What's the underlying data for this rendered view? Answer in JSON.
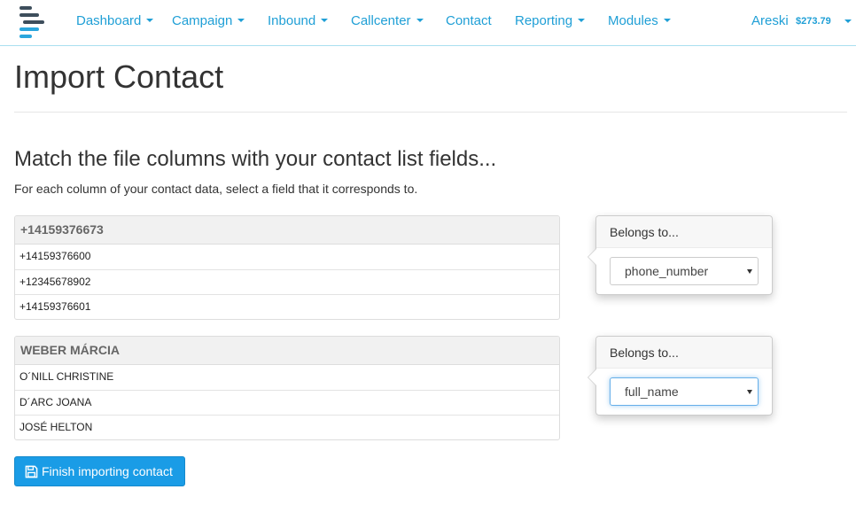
{
  "navbar": {
    "items": [
      {
        "label": "Dashboard",
        "has_caret": true
      },
      {
        "label": "Campaign",
        "has_caret": true
      },
      {
        "label": "Inbound",
        "has_caret": true
      },
      {
        "label": "Callcenter",
        "has_caret": true
      },
      {
        "label": "Contact",
        "has_caret": false
      },
      {
        "label": "Reporting",
        "has_caret": true
      },
      {
        "label": "Modules",
        "has_caret": true
      }
    ],
    "user": {
      "name": "Areski",
      "balance": "$273.79"
    },
    "logo_icon": "logo-stacked-bars-icon",
    "accent_color": "#1f9fd6"
  },
  "page": {
    "title": "Import Contact",
    "section_title": "Match the file columns with your contact list fields...",
    "section_desc": "For each column of your contact data, select a field that it corresponds to."
  },
  "columns": [
    {
      "header": "+14159376673",
      "rows": [
        "+14159376600",
        "+12345678902",
        "+14159376601"
      ],
      "belongs_label": "Belongs to...",
      "selected_field": "phone_number",
      "focused": false
    },
    {
      "header": "WEBER MÁRCIA",
      "rows": [
        "O´NILL CHRISTINE",
        "D´ARC JOANA",
        "JOSÉ HELTON"
      ],
      "belongs_label": "Belongs to...",
      "selected_field": "full_name",
      "focused": true
    }
  ],
  "finish_button": {
    "label": "Finish importing contact",
    "icon": "floppy-disk-icon",
    "color": "#1a9ce6"
  }
}
